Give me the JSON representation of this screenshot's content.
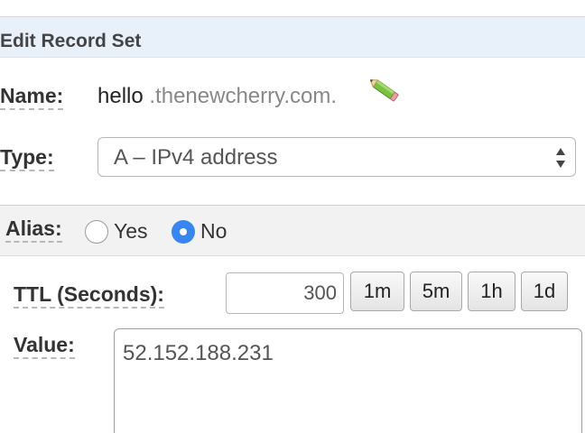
{
  "panel": {
    "title": "Edit Record Set"
  },
  "name": {
    "label": "Name:",
    "host": "hello",
    "domain": " .thenewcherry.com.",
    "edit_icon": "pencil-icon"
  },
  "type": {
    "label": "Type:",
    "selected": "A – IPv4 address",
    "arrows_icon": "select-updown-arrows-icon"
  },
  "alias": {
    "label": "Alias:",
    "options": [
      {
        "label": "Yes",
        "checked": false
      },
      {
        "label": "No",
        "checked": true
      }
    ],
    "accent_color": "#3a86f0"
  },
  "ttl": {
    "label": "TTL (Seconds):",
    "value": "300",
    "presets": [
      "1m",
      "5m",
      "1h",
      "1d"
    ]
  },
  "value": {
    "label": "Value:",
    "text": "52.152.188.231"
  }
}
